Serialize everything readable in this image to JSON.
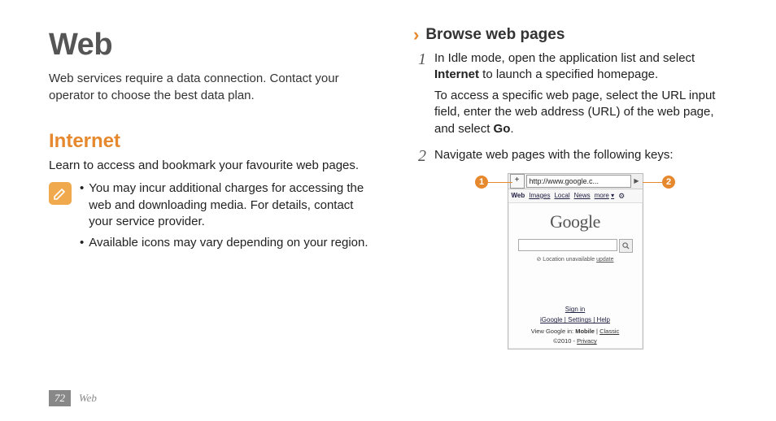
{
  "left": {
    "title": "Web",
    "intro": "Web services require a data connection. Contact your operator to choose the best data plan.",
    "section_heading": "Internet",
    "section_sub": "Learn to access and bookmark your favourite web pages.",
    "note_bullets": [
      "You may incur additional charges for accessing the web and downloading media. For details, contact your service provider.",
      "Available icons may vary depending on your region."
    ]
  },
  "right": {
    "subsection_heading": "Browse web pages",
    "steps": [
      {
        "num": "1",
        "para1_pre": "In Idle mode, open the application list and select ",
        "para1_bold": "Internet",
        "para1_post": " to launch a specified homepage.",
        "para2_pre": "To access a specific web page, select the URL input field, enter the web address (URL) of the web page, and select ",
        "para2_bold": "Go",
        "para2_post": "."
      },
      {
        "num": "2",
        "para1_pre": "Navigate web pages with the following keys:",
        "para1_bold": "",
        "para1_post": ""
      }
    ],
    "callouts": {
      "c1": "1",
      "c2": "2"
    },
    "phone": {
      "plus": "+",
      "url": "http://www.google.c...",
      "tri": "▶",
      "tabs": {
        "web": "Web",
        "images": "Images",
        "local": "Local",
        "news": "News",
        "more": "more",
        "caret": "▾",
        "gear": "⚙"
      },
      "logo": "Google",
      "search_icon_alt": "🔍",
      "loc_prefix": "⊘ Location unavailable ",
      "loc_link": "update",
      "signin": "Sign in",
      "links_sep": " | ",
      "links": {
        "iGoogle": "iGoogle",
        "settings": "Settings",
        "help": "Help"
      },
      "mode_prefix": "View Google in: ",
      "mode_bold": "Mobile",
      "mode_sep": " | ",
      "mode_link": "Classic",
      "copy_prefix": "©2010 - ",
      "copy_link": "Privacy"
    }
  },
  "footer": {
    "page": "72",
    "chapter": "Web"
  }
}
